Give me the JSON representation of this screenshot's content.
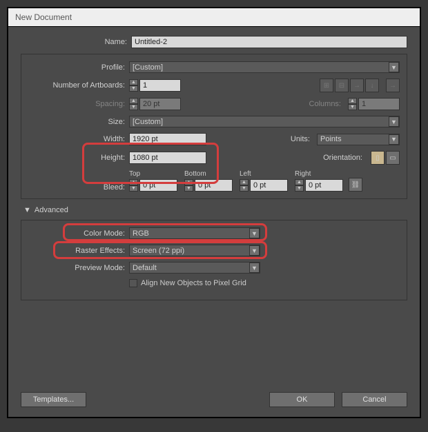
{
  "title": "New Document",
  "labels": {
    "name": "Name:",
    "profile": "Profile:",
    "numArtboards": "Number of Artboards:",
    "spacing": "Spacing:",
    "columns": "Columns:",
    "size": "Size:",
    "width": "Width:",
    "height": "Height:",
    "units": "Units:",
    "orientation": "Orientation:",
    "bleed": "Bleed:",
    "top": "Top",
    "bottom": "Bottom",
    "left": "Left",
    "right": "Right",
    "colorMode": "Color Mode:",
    "rasterEffects": "Raster Effects:",
    "previewMode": "Preview Mode:",
    "alignPixel": "Align New Objects to Pixel Grid"
  },
  "values": {
    "name": "Untitled-2",
    "profile": "[Custom]",
    "artboards": "1",
    "spacing": "20 pt",
    "columns": "1",
    "size": "[Custom]",
    "width": "1920 pt",
    "height": "1080 pt",
    "units": "Points",
    "bleed": "0 pt",
    "colorMode": "RGB",
    "rasterEffects": "Screen (72 ppi)",
    "previewMode": "Default"
  },
  "advanced": "Advanced",
  "buttons": {
    "templates": "Templates...",
    "ok": "OK",
    "cancel": "Cancel"
  }
}
